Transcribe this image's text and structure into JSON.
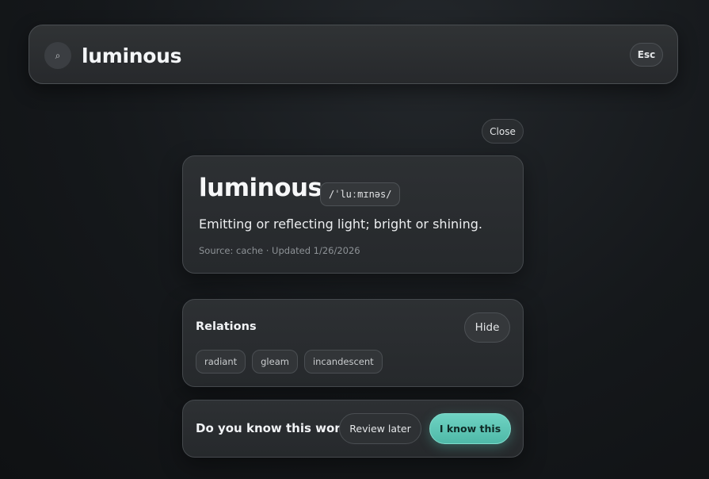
{
  "search": {
    "value": "luminous",
    "icon": "search-icon",
    "esc_label": "Esc"
  },
  "close_label": "Close",
  "entry": {
    "word": "luminous",
    "phonetic": "/ˈluːmɪnəs/",
    "definition": "Emitting or reflecting light; bright or shining.",
    "source_line": "Source: cache · Updated 1/26/2026"
  },
  "relations": {
    "title": "Relations",
    "hide_label": "Hide",
    "items": [
      "radiant",
      "gleam",
      "incandescent"
    ]
  },
  "know": {
    "question": "Do you know this word?",
    "review_label": "Review later",
    "know_label": "I know this"
  },
  "colors": {
    "accent": "#5cc4b3",
    "background": "#15181b",
    "card": "#2a2d30"
  }
}
